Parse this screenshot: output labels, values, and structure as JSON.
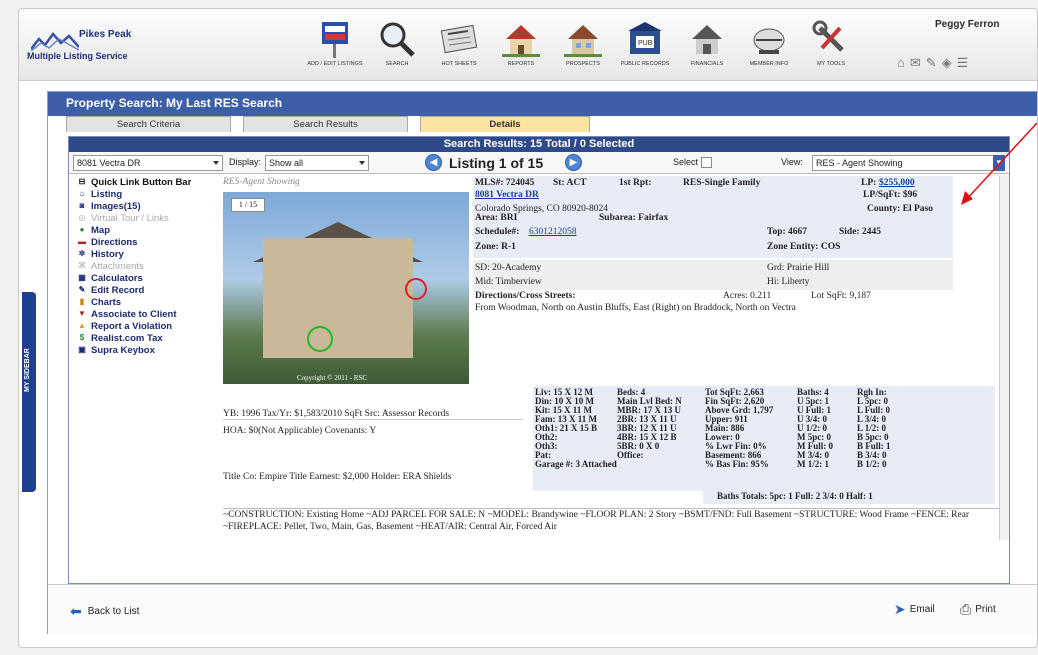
{
  "header": {
    "logo_line1": "Pikes Peak",
    "logo_line2": "Multiple Listing Service",
    "user": "Peggy Ferron",
    "nav": [
      {
        "label": "Add / Edit Listings"
      },
      {
        "label": "Search"
      },
      {
        "label": "Hot Sheets"
      },
      {
        "label": "Reports"
      },
      {
        "label": "Prospects"
      },
      {
        "label": "Public Records"
      },
      {
        "label": "Financials"
      },
      {
        "label": "Member Info"
      },
      {
        "label": "My Tools"
      }
    ]
  },
  "sidebar": {
    "label": "MY SIDEBAR"
  },
  "page": {
    "title": "Property Search:   My Last RES Search",
    "tabs": [
      "Search Criteria",
      "Search Results",
      "Details"
    ]
  },
  "results": {
    "header": "Search Results: 15 Total / 0 Selected",
    "address_select": "8081 Vectra DR",
    "display_label": "Display:",
    "display_value": "Show all",
    "listing_label": "Listing 1 of 15",
    "select_label": "Select",
    "view_label": "View:",
    "view_value": "RES - Agent Showing"
  },
  "links": {
    "head": "Quick Link Button Bar",
    "items": [
      "Listing",
      "Images(15)",
      "Virtual Tour / Links",
      "Map",
      "Directions",
      "History",
      "Attachments",
      "Calculators",
      "Edit Record",
      "Charts",
      "Associate to Client",
      "Report a Violation",
      "Realist.com Tax",
      "Supra Keybox"
    ]
  },
  "detail": {
    "report_title": "RES-Agent Showing",
    "photo_count": "1 / 15",
    "copyright": "Copyright © 2011 - RSC",
    "mls": "MLS#: 724045",
    "st": "St: ACT",
    "rpt": "1st Rpt:",
    "type": "RES-Single Family",
    "lp_label": "LP:",
    "lp": "$255,000",
    "address": "8081 Vectra DR",
    "lpsqft": "LP/SqFt: $96",
    "city": "Colorado Springs,  CO  80920-8024",
    "county": "County: El Paso",
    "area": "Area: BRI",
    "subarea": "Subarea: Fairfax",
    "schedule_label": "Schedule#:",
    "schedule": "6301212058",
    "top": "Top: 4667",
    "side": "Side: 2445",
    "zone": "Zone: R-1",
    "zone_entity": "Zone Entity:  COS",
    "sd": "SD: 20-Academy",
    "grd": "Grd: Prairie Hill",
    "mid": "Mid:  Timberview",
    "hi": "Hi:  Liberty",
    "dir_label": "Directions/Cross Streets:",
    "acres": "Acres: 0.211",
    "lot": "Lot SqFt: 9,187",
    "directions": "From Woodman, North on Austin Bluffs, East (Right) on Braddock, North on Vectra",
    "yb": "YB: 1996 Tax/Yr: $1,583/2010  SqFt Src: Assessor Records",
    "hoa": "HOA: $0(Not Applicable)  Covenants: Y",
    "title_co": "Title Co: Empire Title  Earnest: $2,000 Holder: ERA Shields",
    "rooms": [
      "Liv:  15 X 12 M",
      "Din:  10 X 10 M",
      "Kit:  15 X 11 M",
      "Fam:  13 X 11 M",
      "Oth1: 21 X 15 B",
      "Oth2:",
      "Oth3:",
      "Pat:"
    ],
    "beds": [
      "Beds:  4",
      "Main Lvl Bed: N",
      "MBR:  17 X 13 U",
      "2BR:  13 X 11 U",
      "3BR:  12 X 11 U",
      "4BR:  15 X 12 B",
      "5BR:  0 X 0",
      "Office:"
    ],
    "garage": "Garage #: 3 Attached",
    "sqft": [
      "Tot SqFt:  2,663",
      "Fin SqFt:  2,620",
      "Above Grd: 1,797",
      "Upper:  911",
      "Main:  886",
      "Lower:  0",
      "% Lwr Fin:  0%",
      "Basement:  866",
      "% Bas Fin:  95%"
    ],
    "baths": [
      "Baths: 4",
      "U 5pc: 1",
      "U Full: 1",
      "U 3/4:  0",
      "U 1/2:  0",
      "M 5pc: 0",
      "M Full: 0",
      "M 3/4:  0",
      "M 1/2:  1"
    ],
    "rgh": [
      "Rgh In:",
      "L 5pc:  0",
      "L Full:  0",
      "L 3/4:  0",
      "L 1/2:  0",
      "B 5pc:  0",
      "B Full:  1",
      "B 3/4:  0",
      "B 1/2:  0"
    ],
    "baths_totals": "Baths Totals:  5pc: 1  Full: 2  3/4: 0  Half: 1",
    "remarks": "~CONSTRUCTION: Existing Home ~ADJ PARCEL FOR SALE: N ~MODEL: Brandywine ~FLOOR PLAN: 2 Story ~BSMT/FND: Full Basement ~STRUCTURE: Wood Frame ~FENCE: Rear ~FIREPLACE: Pellet, Two, Main, Gas, Basement ~HEAT/AIR: Central Air, Forced Air"
  },
  "footer": {
    "back": "Back to List",
    "email": "Email",
    "print": "Print"
  }
}
